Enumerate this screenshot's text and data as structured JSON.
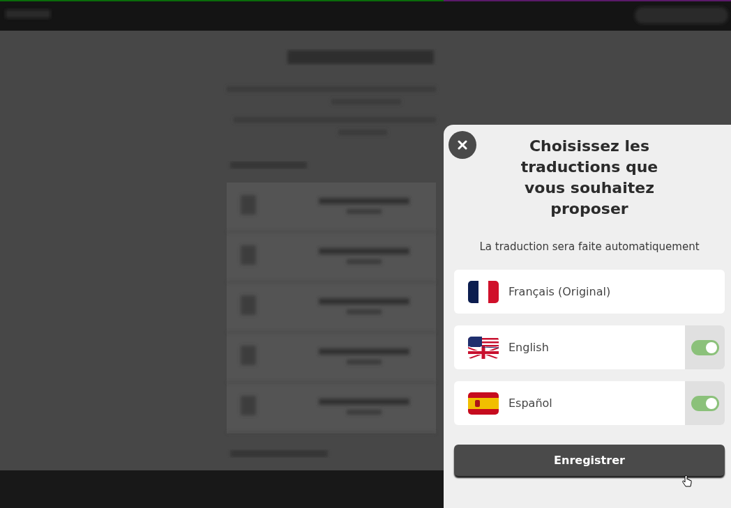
{
  "dialog": {
    "title": "Choisissez les traductions que vous souhaitez proposer",
    "subtitle": "La traduction sera faite automatiquement",
    "languages": [
      {
        "label": "Français (Original)",
        "kind": "original"
      },
      {
        "label": "English",
        "kind": "toggle",
        "on": true
      },
      {
        "label": "Español",
        "kind": "toggle",
        "on": true
      }
    ],
    "save_button": "Enregistrer"
  }
}
